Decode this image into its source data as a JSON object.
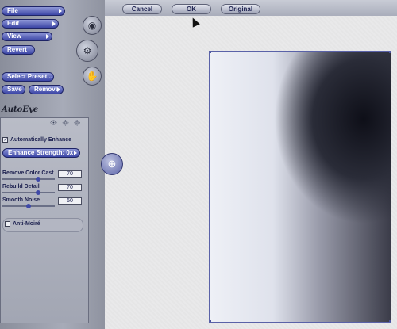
{
  "top_bar": {
    "cancel_label": "Cancel",
    "ok_label": "OK",
    "original_label": "Original"
  },
  "menu": {
    "file_label": "File",
    "edit_label": "Edit",
    "view_label": "View",
    "revert_label": "Revert",
    "select_preset_label": "Select Preset...",
    "save_label": "Save",
    "remove_label": "Remove"
  },
  "panel": {
    "title": "AutoEye",
    "auto_enhance_label": "Automatically Enhance",
    "auto_enhance_checked": true,
    "enhance_strength_label": "Enhance Strength: 0x",
    "sliders": [
      {
        "label": "Remove Color Cast",
        "value": "70",
        "level": 0.7
      },
      {
        "label": "Rebuild Detail",
        "value": "70",
        "level": 0.7
      },
      {
        "label": "Smooth Noise",
        "value": "50",
        "level": 0.5
      }
    ],
    "anti_moire_label": "Anti-Moiré",
    "anti_moire_checked": false
  },
  "colors": {
    "accent": "#3b45a6",
    "panel_bg": "#a7abb8",
    "canvas_bg": "#e9e9ea"
  }
}
